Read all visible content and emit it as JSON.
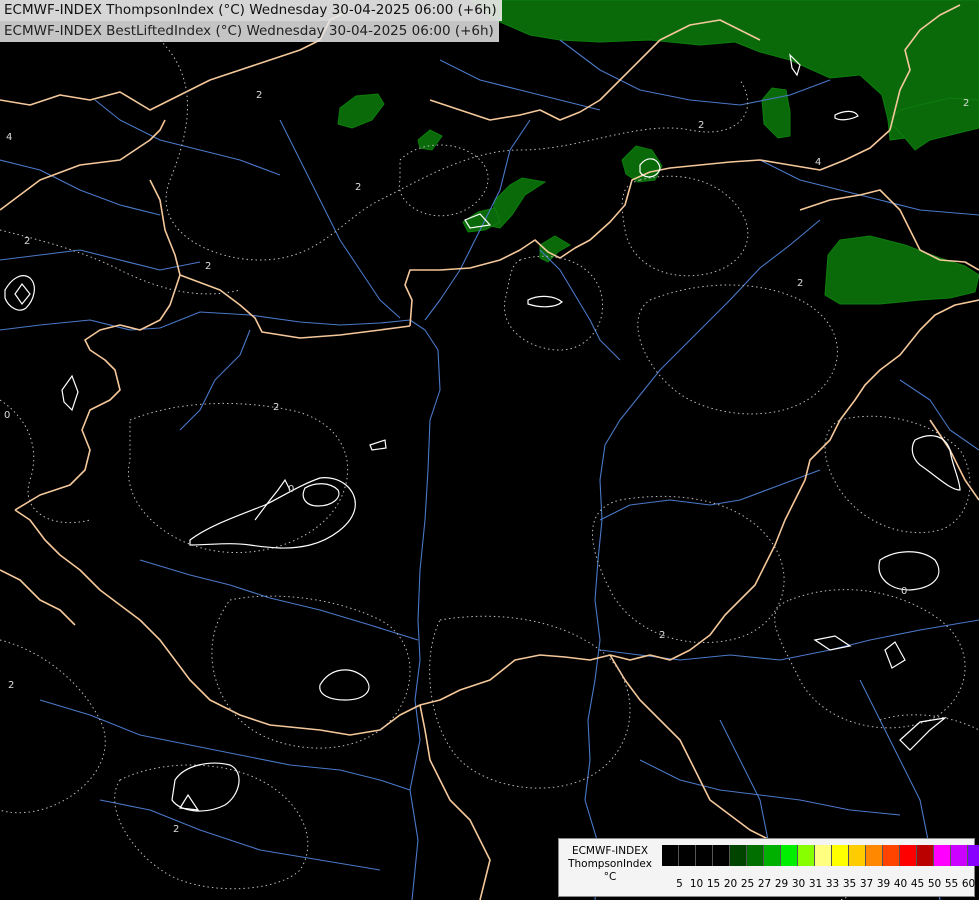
{
  "header": {
    "title_line1": "ECMWF-INDEX ThompsonIndex (°C) Wednesday 30-04-2025 06:00 (+6h)",
    "title_line2": "ECMWF-INDEX BestLiftedIndex (°C) Wednesday 30-04-2025 06:00 (+6h)"
  },
  "legend": {
    "line1": "ECMWF-INDEX",
    "line2": "ThompsonIndex",
    "line3": "°C",
    "ticks": [
      "5",
      "10",
      "15",
      "20",
      "25",
      "27",
      "29",
      "30",
      "31",
      "33",
      "35",
      "37",
      "39",
      "40",
      "45",
      "50",
      "55",
      "60"
    ],
    "colors": [
      "#000000",
      "#000000",
      "#000000",
      "#000000",
      "#004400",
      "#006f00",
      "#00b000",
      "#00ee00",
      "#88ff00",
      "#ffff80",
      "#ffff00",
      "#ffcc00",
      "#ff8800",
      "#ff4400",
      "#ff0000",
      "#bb0000",
      "#ff00ff",
      "#cc00ff",
      "#8800ff",
      "#4400ff",
      "#0000ff"
    ]
  },
  "contour_labels": [
    {
      "text": "2",
      "name": "label-2-north"
    },
    {
      "text": "2",
      "name": "label-2-northwest"
    },
    {
      "text": "4",
      "name": "label-4-west"
    },
    {
      "text": "2",
      "name": "label-2-west"
    },
    {
      "text": "2",
      "name": "label-2-slovakia"
    },
    {
      "text": "2",
      "name": "label-2-center"
    },
    {
      "text": "0",
      "name": "label-0-transdanubia"
    },
    {
      "text": "0",
      "name": "label-0-west"
    },
    {
      "text": "2",
      "name": "label-2-east"
    },
    {
      "text": "2",
      "name": "label-2-southeast"
    },
    {
      "text": "0",
      "name": "label-0-romania"
    },
    {
      "text": "2",
      "name": "label-2-southwest"
    },
    {
      "text": "2",
      "name": "label-2-croatia"
    },
    {
      "text": "4",
      "name": "label-4-ukraine"
    },
    {
      "text": "2",
      "name": "label-2-poland"
    },
    {
      "text": "2",
      "name": "label-2-far-east"
    }
  ],
  "colors": {
    "background": "#000000",
    "border": "#f5c89b",
    "river": "#4a78c8",
    "thompson_fill": "#0a6a0a",
    "lifted_contour": "#ffffff"
  }
}
